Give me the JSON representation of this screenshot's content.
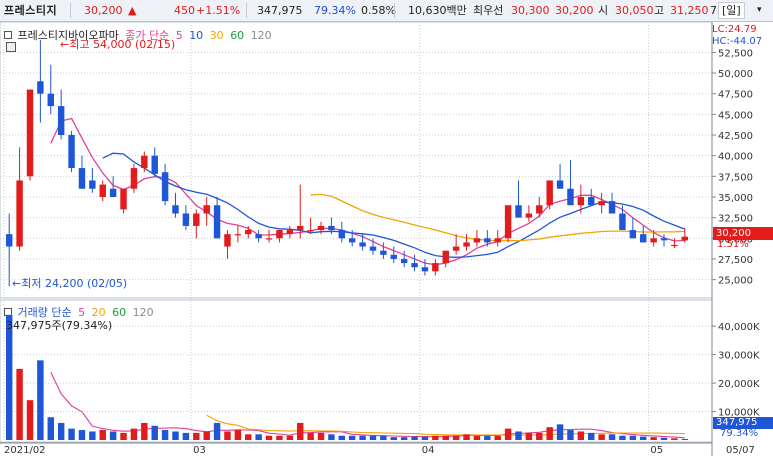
{
  "header": {
    "stock_name": "프레스티지",
    "price": "30,200",
    "change_icon": "up-triangle-icon",
    "change": "450",
    "change_pct": "+1.51%",
    "volume": "347,975",
    "volume_ratio": "79.34%",
    "turnover": "0.58%",
    "trade_value": "10,630백만",
    "best_label": "최우선",
    "ask": "30,300",
    "bid": "30,200",
    "open_label": "시",
    "open": "30,050",
    "high_label": "고",
    "high": "31,250",
    "truncated": "7",
    "mode_button": "[일]",
    "mode_dropdown": "▾"
  },
  "price_pane": {
    "title": "프레스티지바이오파마",
    "ma_label": "종가 단순",
    "ma_periods": [
      "5",
      "10",
      "30",
      "60",
      "120"
    ],
    "ma_colors": [
      "#e0409a",
      "#1f56d8",
      "#f2a400",
      "#1aa03a",
      "#8a8a8a"
    ],
    "max_marker": "최고 54,000 (02/15)",
    "min_marker": "최저 24,200 (02/05)",
    "lc": "LC:24.79",
    "hc": "HC:-44.07",
    "current_price_tag": "30,200",
    "current_pct_tag": "1.51%",
    "y_ticks": [
      "52,500",
      "50,000",
      "47,500",
      "45,000",
      "42,500",
      "40,000",
      "37,500",
      "35,000",
      "32,500",
      "30,000",
      "27,500",
      "25,000"
    ]
  },
  "volume_pane": {
    "title": "거래량 단순",
    "ma_periods": [
      "5",
      "20",
      "60",
      "120"
    ],
    "ma_colors": [
      "#e0409a",
      "#f2a400",
      "#1aa03a",
      "#8a8a8a"
    ],
    "volume_note": "347,975주(79.34%)",
    "y_ticks": [
      "40,000K",
      "30,000K",
      "20,000K",
      "10,000K"
    ],
    "current_tag": "347,975",
    "current_pct_tag": "79.34%"
  },
  "x_axis": {
    "ticks": [
      "2021/02",
      "03",
      "04",
      "05"
    ],
    "right_label": "05/07"
  },
  "colors": {
    "up": "#e21b1b",
    "down": "#1f56d8",
    "grid": "#c9ced6",
    "bg": "#ffffff"
  },
  "chart_data": {
    "type": "candlestick",
    "x": [
      "02/01",
      "02/02",
      "02/03",
      "02/04",
      "02/05",
      "02/08",
      "02/09",
      "02/10",
      "02/15",
      "02/16",
      "02/17",
      "02/18",
      "02/19",
      "02/22",
      "02/23",
      "02/24",
      "02/25",
      "02/26",
      "03/02",
      "03/03",
      "03/04",
      "03/05",
      "03/08",
      "03/09",
      "03/10",
      "03/11",
      "03/12",
      "03/15",
      "03/16",
      "03/17",
      "03/18",
      "03/19",
      "03/22",
      "03/23",
      "03/24",
      "03/25",
      "03/26",
      "03/29",
      "03/30",
      "03/31",
      "04/01",
      "04/02",
      "04/05",
      "04/06",
      "04/07",
      "04/08",
      "04/09",
      "04/12",
      "04/13",
      "04/14",
      "04/15",
      "04/16",
      "04/19",
      "04/20",
      "04/21",
      "04/22",
      "04/23",
      "04/26",
      "04/27",
      "04/28",
      "04/29",
      "04/30",
      "05/03",
      "05/04",
      "05/06",
      "05/07"
    ],
    "open": [
      30500,
      29000,
      37500,
      49000,
      47500,
      46000,
      42500,
      38500,
      37000,
      35000,
      36000,
      33500,
      36000,
      38500,
      40000,
      38000,
      34000,
      33000,
      31500,
      33000,
      34000,
      29000,
      30500,
      30500,
      30500,
      30000,
      30000,
      30500,
      31000,
      31000,
      31000,
      31500,
      31000,
      30000,
      29500,
      29000,
      28500,
      28000,
      27500,
      27000,
      26500,
      26000,
      27000,
      28500,
      29000,
      29500,
      30000,
      29500,
      30000,
      34000,
      32500,
      33000,
      34000,
      37000,
      36000,
      34000,
      35000,
      34000,
      34500,
      33000,
      31000,
      30500,
      29500,
      30000,
      29200,
      29750
    ],
    "high": [
      33000,
      41000,
      48000,
      54000,
      51000,
      48000,
      43000,
      40000,
      38500,
      37000,
      37500,
      36000,
      39000,
      40500,
      41000,
      39000,
      35500,
      34000,
      33500,
      35000,
      35000,
      31000,
      31500,
      31500,
      31000,
      31000,
      31000,
      31500,
      36500,
      32500,
      32000,
      32500,
      32000,
      31000,
      30500,
      30000,
      29500,
      29000,
      28500,
      28000,
      27500,
      27500,
      28500,
      30500,
      30500,
      31000,
      31000,
      31000,
      31500,
      37000,
      34000,
      35000,
      36000,
      39000,
      39500,
      36500,
      36000,
      35500,
      35500,
      34000,
      32500,
      31500,
      31000,
      30500,
      30000,
      31250
    ],
    "low": [
      24200,
      28500,
      37000,
      44000,
      45000,
      42000,
      38000,
      36000,
      35500,
      34500,
      35000,
      33000,
      35500,
      38000,
      37500,
      34000,
      32500,
      31000,
      30000,
      31500,
      30000,
      27500,
      29500,
      30000,
      29500,
      29500,
      29500,
      30000,
      30000,
      30500,
      30500,
      30500,
      29500,
      29000,
      28500,
      28000,
      27500,
      27000,
      26500,
      26000,
      25500,
      25500,
      26500,
      28000,
      28500,
      29000,
      29000,
      29000,
      29500,
      33000,
      32000,
      32500,
      33500,
      36000,
      35500,
      33000,
      34000,
      33000,
      33000,
      31000,
      30000,
      29500,
      29000,
      29000,
      28800,
      29500
    ],
    "close": [
      29000,
      37000,
      48000,
      47500,
      46000,
      42500,
      38500,
      36000,
      36000,
      36500,
      35000,
      36000,
      38500,
      40000,
      37800,
      34500,
      33000,
      31500,
      33000,
      34000,
      30000,
      30500,
      30500,
      31000,
      30000,
      30000,
      31000,
      31000,
      31500,
      31000,
      31500,
      31000,
      30000,
      29500,
      29000,
      28500,
      28000,
      27500,
      27000,
      26500,
      26000,
      27000,
      28500,
      29000,
      29500,
      30000,
      29500,
      30000,
      34000,
      32500,
      33000,
      34000,
      37000,
      36000,
      34000,
      35000,
      34000,
      34500,
      33000,
      31000,
      30000,
      29500,
      30000,
      29750,
      29200,
      30200
    ],
    "volume_k": [
      44000,
      25000,
      14000,
      28000,
      8000,
      6000,
      4000,
      3500,
      3000,
      3500,
      3000,
      2500,
      4000,
      6000,
      5000,
      3500,
      3000,
      2500,
      2500,
      3000,
      6000,
      3000,
      3500,
      2000,
      2000,
      1500,
      1500,
      1500,
      6000,
      2500,
      2500,
      2000,
      1500,
      1500,
      1500,
      1500,
      1500,
      1000,
      1000,
      1200,
      1200,
      1500,
      1500,
      1500,
      2000,
      1500,
      1500,
      1500,
      4000,
      3000,
      2500,
      2500,
      4500,
      5500,
      3500,
      3000,
      2500,
      2000,
      2000,
      1500,
      1500,
      1200,
      1000,
      800,
      600,
      348
    ]
  }
}
